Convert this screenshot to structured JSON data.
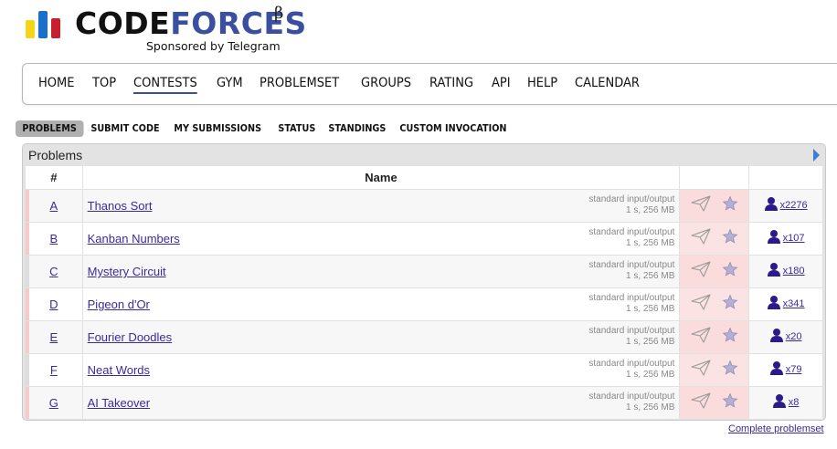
{
  "logo": {
    "text_part1": "CODE",
    "text_part2": "FORCES",
    "beta": "β",
    "sponsor": "Sponsored by Telegram"
  },
  "main_menu": {
    "items": [
      {
        "label": "HOME",
        "active": false
      },
      {
        "label": "TOP",
        "active": false
      },
      {
        "label": "CONTESTS",
        "active": true
      },
      {
        "label": "GYM",
        "active": false
      },
      {
        "label": "PROBLEMSET",
        "active": false
      },
      {
        "label": "GROUPS",
        "active": false
      },
      {
        "label": "RATING",
        "active": false
      },
      {
        "label": "API",
        "active": false
      },
      {
        "label": "HELP",
        "active": false
      },
      {
        "label": "CALENDAR",
        "active": false
      }
    ]
  },
  "sub_menu": {
    "items": [
      {
        "label": "PROBLEMS",
        "active": true
      },
      {
        "label": "SUBMIT CODE",
        "active": false
      },
      {
        "label": "MY SUBMISSIONS",
        "active": false
      },
      {
        "label": "STATUS",
        "active": false
      },
      {
        "label": "STANDINGS",
        "active": false
      },
      {
        "label": "CUSTOM INVOCATION",
        "active": false
      }
    ]
  },
  "problems_box": {
    "title": "Problems",
    "headers": {
      "index": "#",
      "name": "Name"
    },
    "rows": [
      {
        "index": "A",
        "name": "Thanos Sort",
        "io": "standard input/output",
        "limits": "1 s, 256 MB",
        "solved": "x2276"
      },
      {
        "index": "B",
        "name": "Kanban Numbers",
        "io": "standard input/output",
        "limits": "1 s, 256 MB",
        "solved": "x107"
      },
      {
        "index": "C",
        "name": "Mystery Circuit",
        "io": "standard input/output",
        "limits": "1 s, 256 MB",
        "solved": "x180"
      },
      {
        "index": "D",
        "name": "Pigeon d'Or",
        "io": "standard input/output",
        "limits": "1 s, 256 MB",
        "solved": "x341"
      },
      {
        "index": "E",
        "name": "Fourier Doodles",
        "io": "standard input/output",
        "limits": "1 s, 256 MB",
        "solved": "x20"
      },
      {
        "index": "F",
        "name": "Neat Words",
        "io": "standard input/output",
        "limits": "1 s, 256 MB",
        "solved": "x79"
      },
      {
        "index": "G",
        "name": "AI Takeover",
        "io": "standard input/output",
        "limits": "1 s, 256 MB",
        "solved": "x8"
      }
    ]
  },
  "footer": {
    "complete_link": "Complete problemset"
  },
  "colors": {
    "accent": "#3b4fa0",
    "link": "#3b2a9c",
    "accepted_row": "#f8c9c9"
  },
  "icons": {
    "submit": "paper-plane-icon",
    "favorite": "star-icon",
    "solvers": "user-icon",
    "expand": "arrow-right-icon"
  }
}
